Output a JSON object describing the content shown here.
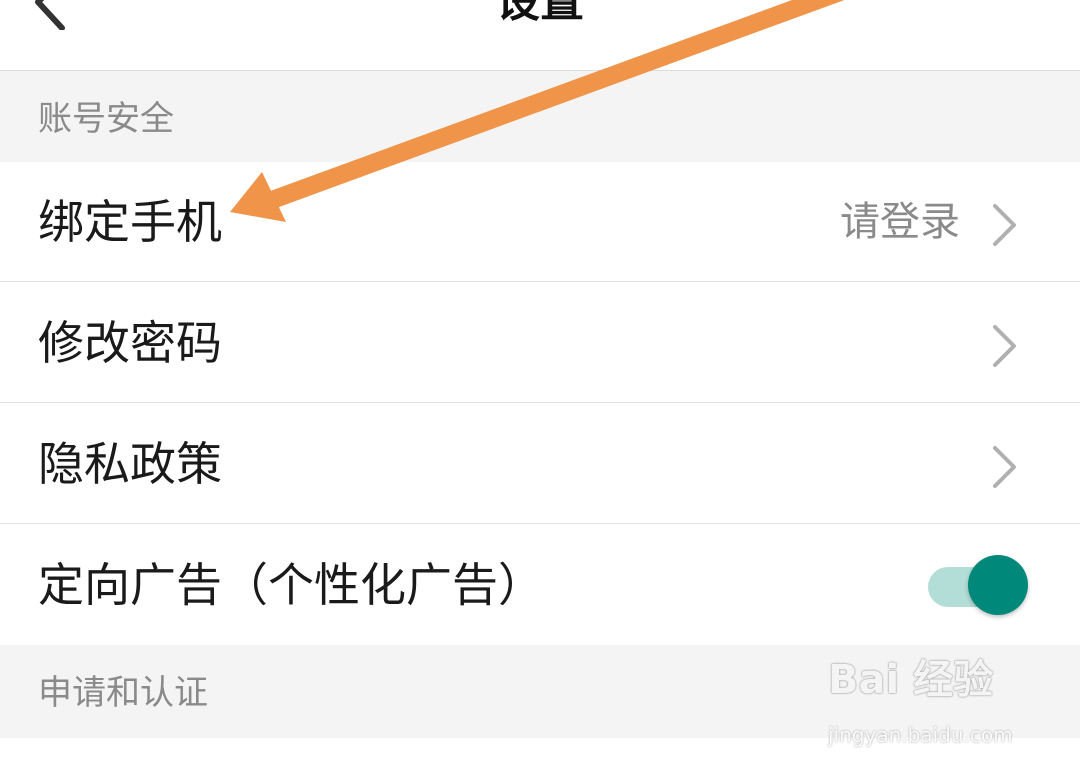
{
  "header": {
    "title": "设置",
    "back_icon": "chevron-left-icon"
  },
  "sections": [
    {
      "title": "账号安全",
      "rows": [
        {
          "label": "绑定手机",
          "value": "请登录",
          "trailing": "chevron-right-icon"
        },
        {
          "label": "修改密码",
          "trailing": "chevron-right-icon"
        },
        {
          "label": "隐私政策",
          "trailing": "chevron-right-icon"
        },
        {
          "label": "定向广告（个性化广告）",
          "toggle_on": true
        }
      ]
    },
    {
      "title": "申请和认证",
      "rows": []
    }
  ],
  "annotation": {
    "color": "#f0944a"
  },
  "watermark": {
    "logo": "Bai 经验",
    "url": "jingyan.baidu.com"
  },
  "colors": {
    "toggle_knob": "#00897b",
    "toggle_track": "#b3ddd7",
    "section_bg": "#f4f4f4"
  }
}
